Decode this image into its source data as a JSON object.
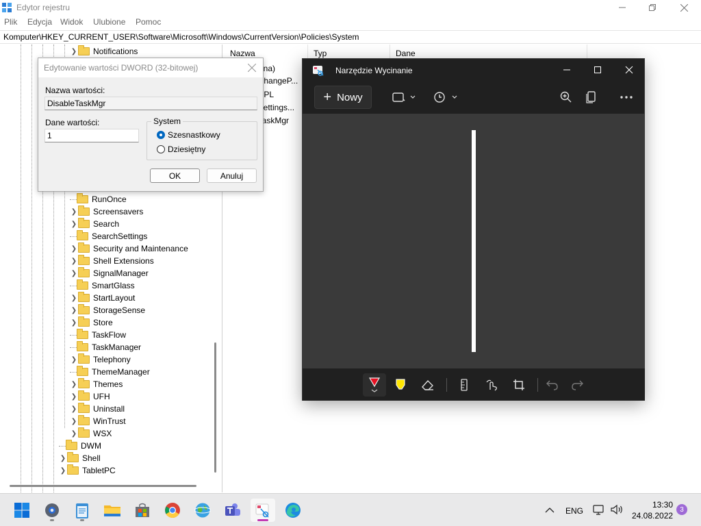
{
  "regedit": {
    "title": "Edytor rejestru",
    "menu": [
      "Plik",
      "Edycja",
      "Widok",
      "Ulubione",
      "Pomoc"
    ],
    "address": "Komputer\\HKEY_CURRENT_USER\\Software\\Microsoft\\Windows\\CurrentVersion\\Policies\\System",
    "tree_items": [
      {
        "label": "Notifications",
        "expandable": true
      },
      {
        "label": "RunOnce",
        "expandable": false
      },
      {
        "label": "Screensavers",
        "expandable": true
      },
      {
        "label": "Search",
        "expandable": true
      },
      {
        "label": "SearchSettings",
        "expandable": false
      },
      {
        "label": "Security and Maintenance",
        "expandable": true
      },
      {
        "label": "Shell Extensions",
        "expandable": true
      },
      {
        "label": "SignalManager",
        "expandable": true
      },
      {
        "label": "SmartGlass",
        "expandable": false
      },
      {
        "label": "StartLayout",
        "expandable": true
      },
      {
        "label": "StorageSense",
        "expandable": true
      },
      {
        "label": "Store",
        "expandable": true
      },
      {
        "label": "TaskFlow",
        "expandable": false
      },
      {
        "label": "TaskManager",
        "expandable": false
      },
      {
        "label": "Telephony",
        "expandable": true
      },
      {
        "label": "ThemeManager",
        "expandable": false
      },
      {
        "label": "Themes",
        "expandable": true
      },
      {
        "label": "UFH",
        "expandable": true
      },
      {
        "label": "Uninstall",
        "expandable": true
      },
      {
        "label": "WinTrust",
        "expandable": true
      },
      {
        "label": "WSX",
        "expandable": true
      },
      {
        "label": "DWM",
        "expandable": false
      },
      {
        "label": "Shell",
        "expandable": true
      },
      {
        "label": "TabletPC",
        "expandable": true
      }
    ],
    "columns": [
      "Nazwa",
      "Typ",
      "Dane"
    ],
    "values_visible": [
      "yślna)",
      "eChangeP...",
      "pCPL",
      "pSettings...",
      "eTaskMgr"
    ]
  },
  "dialog": {
    "title": "Edytowanie wartości DWORD (32-bitowej)",
    "name_label": "Nazwa wartości:",
    "name_value": "DisableTaskMgr",
    "data_label": "Dane wartości:",
    "data_value": "1",
    "base_group": "System",
    "base_options": [
      "Szesnastkowy",
      "Dziesiętny"
    ],
    "selected_base": "Szesnastkowy",
    "ok_label": "OK",
    "cancel_label": "Anuluj"
  },
  "snipping_tool": {
    "title": "Narzędzie Wycinanie",
    "new_label": "Nowy"
  },
  "taskbar": {
    "apps": [
      "start",
      "settings",
      "notepad",
      "file-explorer",
      "microsoft-store",
      "chrome",
      "network-globe",
      "teams",
      "snipping-tool",
      "edge"
    ],
    "active_app": "snipping-tool",
    "language": "ENG",
    "time": "13:30",
    "date": "24.08.2022",
    "notification_count": "3"
  },
  "colors": {
    "accent": "#0067c0",
    "snip_bg": "#202020",
    "snip_canvas": "#3a3a3a",
    "taskbar_bg": "#e9e9ea",
    "folder": "#f6cf55"
  }
}
